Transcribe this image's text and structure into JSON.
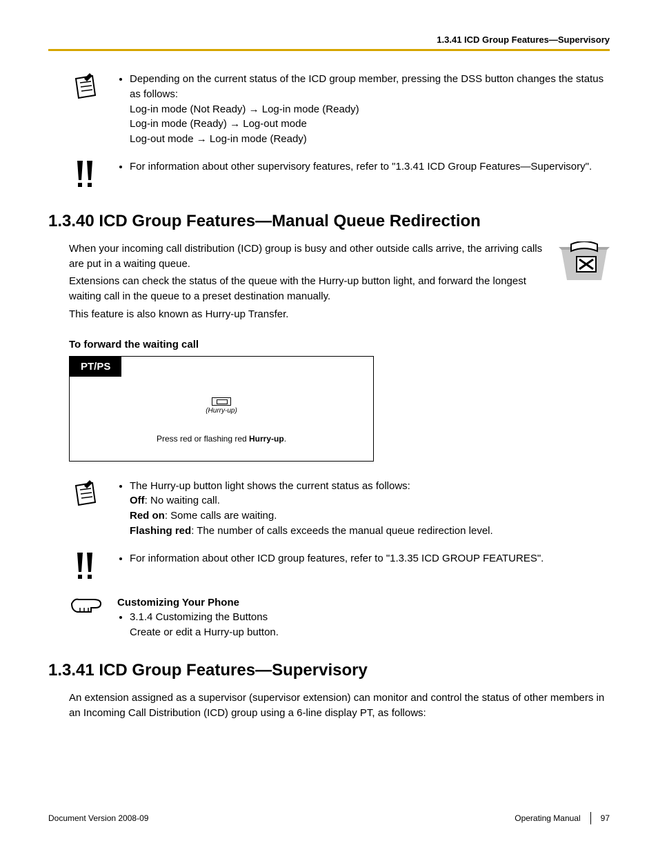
{
  "header_section_ref": "1.3.41 ICD Group Features—Supervisory",
  "note1": {
    "lead": "Depending on the current status of the ICD group member, pressing the DSS button changes the status as follows:",
    "lines": [
      "Log-in mode (Not Ready) → Log-in mode (Ready)",
      "Log-in mode (Ready) → Log-out mode",
      "Log-out mode → Log-in mode (Ready)"
    ]
  },
  "tip1": "For information about other supervisory features, refer to \"1.3.41  ICD Group Features—Supervisory\".",
  "h_1340": "1.3.40  ICD Group Features—Manual Queue Redirection",
  "para_1340": [
    "When your incoming call distribution (ICD) group is busy and other outside calls arrive, the arriving calls are put in a waiting queue.",
    "Extensions can check the status of the queue with the Hurry-up button light, and forward the longest waiting call in the queue to a preset destination manually.",
    "This feature is also known as Hurry-up Transfer."
  ],
  "sub_forward": "To forward the waiting call",
  "proc_tab": "PT/PS",
  "proc_btn_label": "(Hurry-up)",
  "proc_caption_a": "Press red or flashing red ",
  "proc_caption_b": "Hurry-up",
  "proc_caption_c": ".",
  "note2": {
    "lead": "The Hurry-up button light shows the current status as follows:",
    "rows": [
      {
        "b": "Off",
        "t": ": No waiting call."
      },
      {
        "b": "Red on",
        "t": ": Some calls are waiting."
      },
      {
        "b": "Flashing red",
        "t": ": The number of calls exceeds the manual queue redirection level."
      }
    ]
  },
  "tip2": "For information about other ICD group features, refer to \"1.3.35  ICD GROUP FEATURES\".",
  "cust": {
    "title": "Customizing Your Phone",
    "line1": "3.1.4  Customizing the Buttons",
    "line2": "Create or edit a Hurry-up button."
  },
  "h_1341": "1.3.41  ICD Group Features—Supervisory",
  "para_1341": "An extension assigned as a supervisor (supervisor extension) can monitor and control the status of other members in an Incoming Call Distribution (ICD) group using a 6-line display PT, as follows:",
  "footer": {
    "left": "Document Version  2008-09",
    "mid": "Operating Manual",
    "page": "97"
  }
}
